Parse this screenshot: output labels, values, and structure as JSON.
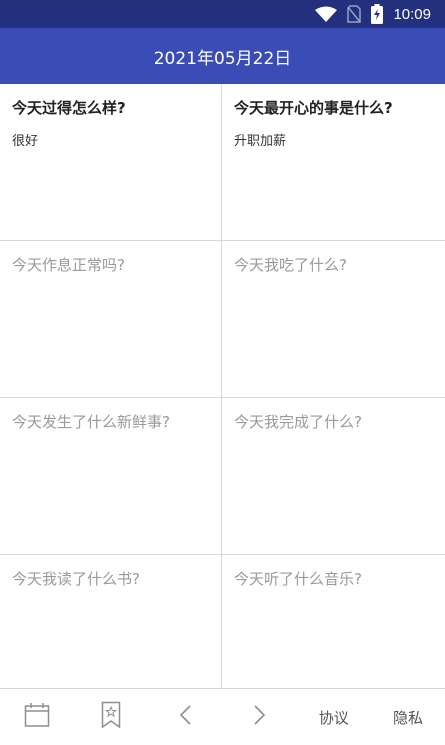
{
  "status": {
    "time": "10:09",
    "icons": [
      "wifi-icon",
      "no-sim-icon",
      "battery-charging-icon"
    ]
  },
  "header": {
    "title": "2021年05月22日"
  },
  "questions": [
    {
      "q": "今天过得怎么样?",
      "a": "很好"
    },
    {
      "q": "今天最开心的事是什么?",
      "a": "升职加薪"
    },
    {
      "q": "今天作息正常吗?",
      "a": ""
    },
    {
      "q": "今天我吃了什么?",
      "a": ""
    },
    {
      "q": "今天发生了什么新鲜事?",
      "a": ""
    },
    {
      "q": "今天我完成了什么?",
      "a": ""
    },
    {
      "q": "今天我读了什么书?",
      "a": ""
    },
    {
      "q": "今天听了什么音乐?",
      "a": ""
    }
  ],
  "bottom": {
    "protocol_label": "协议",
    "privacy_label": "隐私",
    "icons": [
      "calendar-icon",
      "bookmark-icon",
      "prev-icon",
      "next-icon"
    ]
  },
  "colors": {
    "status_bar": "#23307e",
    "header": "#3a4cb5"
  }
}
